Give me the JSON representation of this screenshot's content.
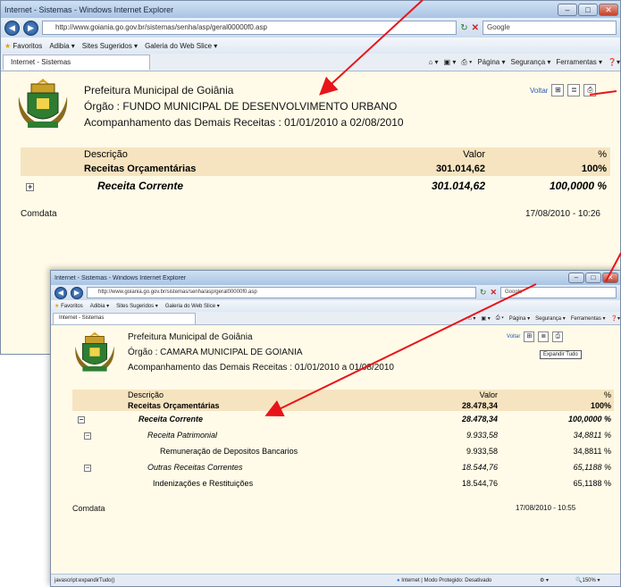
{
  "window1": {
    "title": "Internet - Sistemas - Windows Internet Explorer",
    "url": "http://www.goiania.go.gov.br/sistemas/senha/asp/geral00000f0.asp",
    "search_placeholder": "Google",
    "favorites": [
      "Favoritos",
      "Adibia ▾",
      "Sites Sugeridos ▾",
      "Galeria do Web Slice ▾"
    ],
    "tab": "Internet - Sistemas",
    "commands": [
      "Página ▾",
      "Segurança ▾",
      "Ferramentas ▾"
    ],
    "header": {
      "line1": "Prefeitura Municipal de Goiânia",
      "line2": "Órgão : FUNDO MUNICIPAL DE DESENVOLVIMENTO URBANO",
      "line3": "Acompanhamento das Demais Receitas : 01/01/2010  a  02/08/2010"
    },
    "voltar": "Voltar",
    "columns": {
      "desc": "Descrição",
      "val": "Valor",
      "pct": "%"
    },
    "rows": [
      {
        "desc": "Receitas Orçamentárias",
        "val": "301.014,62",
        "pct": "100%"
      },
      {
        "desc": "Receita Corrente",
        "val": "301.014,62",
        "pct": "100,0000 %"
      }
    ],
    "footer": {
      "left": "Comdata",
      "right": "17/08/2010  -  10:26"
    }
  },
  "window2": {
    "title": "Internet - Sistemas - Windows Internet Explorer",
    "url": "http://www.goiania.go.gov.br/sistemas/senha/asp/geral00000f0.asp",
    "search_placeholder": "Google",
    "favorites": [
      "Favoritos",
      "Adibia ▾",
      "Sites Sugeridos ▾",
      "Galeria do Web Slice ▾"
    ],
    "tab": "Internet - Sistemas",
    "commands": [
      "Página ▾",
      "Segurança ▾",
      "Ferramentas ▾"
    ],
    "header": {
      "line1": "Prefeitura Municipal de Goiânia",
      "line2": "Órgão : CAMARA MUNICIPAL DE GOIANIA",
      "line3": "Acompanhamento das Demais Receitas : 01/01/2010  a  01/08/2010"
    },
    "voltar": "Voltar",
    "tooltip": "Expandir Tudo",
    "columns": {
      "desc": "Descrição",
      "val": "Valor",
      "pct": "%"
    },
    "rows": [
      {
        "desc": "Receitas Orçamentárias",
        "val": "28.478,34",
        "pct": "100%"
      },
      {
        "desc": "Receita Corrente",
        "val": "28.478,34",
        "pct": "100,0000 %"
      },
      {
        "desc": "Receita Patrimonial",
        "val": "9.933,58",
        "pct": "34,8811 %"
      },
      {
        "desc": "Remuneração de Depositos Bancarios",
        "val": "9.933,58",
        "pct": "34,8811 %"
      },
      {
        "desc": "Outras Receitas Correntes",
        "val": "18.544,76",
        "pct": "65,1188 %"
      },
      {
        "desc": "Indenizações e Restituições",
        "val": "18.544,76",
        "pct": "65,1188 %"
      }
    ],
    "footer": {
      "left": "Comdata",
      "right": "17/08/2010  -  10:55"
    },
    "status": {
      "left": "javascript:expandirTudo()",
      "zone": "Internet | Modo Protegido: Desativado",
      "zoom": "150%"
    }
  },
  "colors": {
    "arrow": "#e8141b",
    "page_bg": "#fffbe8",
    "header_row": "#f6e4c0"
  }
}
